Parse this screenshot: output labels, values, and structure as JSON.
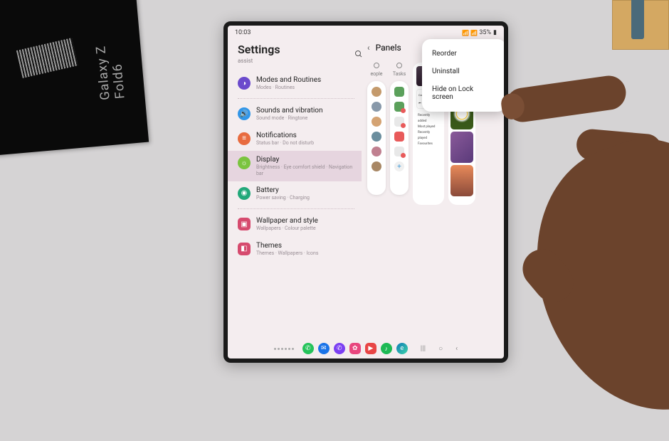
{
  "device_box_label": "Galaxy Z Fold6",
  "status": {
    "time": "10:03",
    "battery": "35%"
  },
  "settings": {
    "title": "Settings",
    "subtitle": "assist",
    "items": [
      {
        "title": "Modes and Routines",
        "sub": "Modes · Routines",
        "color": "#6b4acc"
      },
      {
        "title": "Sounds and vibration",
        "sub": "Sound mode · Ringtone",
        "color": "#3296e8"
      },
      {
        "title": "Notifications",
        "sub": "Status bar · Do not disturb",
        "color": "#e86b3f"
      },
      {
        "title": "Display",
        "sub": "Brightness · Eye comfort shield · Navigation bar",
        "color": "#7bc43f"
      },
      {
        "title": "Battery",
        "sub": "Power saving · Charging",
        "color": "#22a87a"
      },
      {
        "title": "Wallpaper and style",
        "sub": "Wallpapers · Colour palette",
        "color": "#d64a6e"
      },
      {
        "title": "Themes",
        "sub": "Themes · Wallpapers · Icons",
        "color": "#d64a6e"
      }
    ]
  },
  "right": {
    "header": "Panels",
    "col_labels": [
      "eople",
      "Tasks"
    ],
    "media_now": "Calm Rain",
    "playlists": [
      "Recently added",
      "Most played",
      "Recently played",
      "Favourites"
    ]
  },
  "popup": {
    "items": [
      "Reorder",
      "Uninstall",
      "Hide on Lock screen"
    ]
  }
}
